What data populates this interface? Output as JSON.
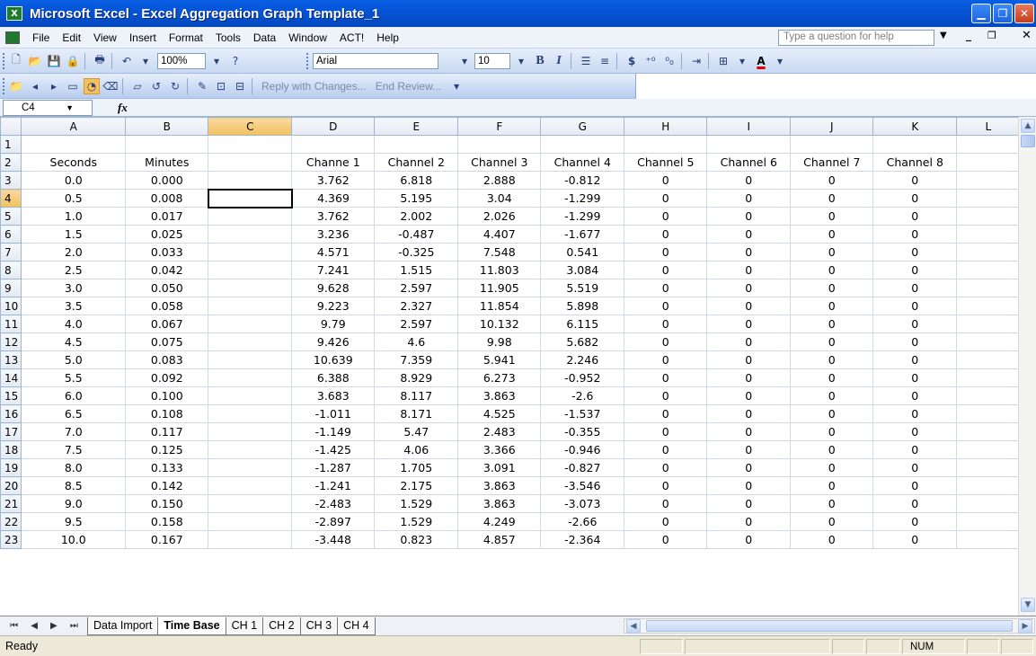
{
  "window": {
    "title": "Microsoft Excel - Excel Aggregation Graph Template_1"
  },
  "menu": {
    "items": [
      "File",
      "Edit",
      "View",
      "Insert",
      "Format",
      "Tools",
      "Data",
      "Window",
      "ACT!",
      "Help"
    ],
    "help_placeholder": "Type a question for help"
  },
  "toolbar": {
    "zoom": "100%",
    "font": "Arial",
    "font_size": "10",
    "bold": "B",
    "italic": "I",
    "currency": "$",
    "reply_with_changes": "Reply with Changes...",
    "end_review": "End Review..."
  },
  "formula_bar": {
    "name_box": "C4",
    "fx": "fx",
    "value": ""
  },
  "grid": {
    "columns": [
      "A",
      "B",
      "C",
      "D",
      "E",
      "F",
      "G",
      "H",
      "I",
      "J",
      "K",
      "L"
    ],
    "active_cell": "C4",
    "rows": [
      [
        "1",
        "",
        "",
        "",
        "",
        "",
        "",
        "",
        "",
        "",
        "",
        "",
        ""
      ],
      [
        "2",
        "Seconds",
        "Minutes",
        "",
        "Channe 1",
        "Channel 2",
        "Channel 3",
        "Channel 4",
        "Channel 5",
        "Channel 6",
        "Channel 7",
        "Channel 8",
        ""
      ],
      [
        "3",
        "0.0",
        "0.000",
        "",
        "3.762",
        "6.818",
        "2.888",
        "-0.812",
        "0",
        "0",
        "0",
        "0",
        ""
      ],
      [
        "4",
        "0.5",
        "0.008",
        "",
        "4.369",
        "5.195",
        "3.04",
        "-1.299",
        "0",
        "0",
        "0",
        "0",
        ""
      ],
      [
        "5",
        "1.0",
        "0.017",
        "",
        "3.762",
        "2.002",
        "2.026",
        "-1.299",
        "0",
        "0",
        "0",
        "0",
        ""
      ],
      [
        "6",
        "1.5",
        "0.025",
        "",
        "3.236",
        "-0.487",
        "4.407",
        "-1.677",
        "0",
        "0",
        "0",
        "0",
        ""
      ],
      [
        "7",
        "2.0",
        "0.033",
        "",
        "4.571",
        "-0.325",
        "7.548",
        "0.541",
        "0",
        "0",
        "0",
        "0",
        ""
      ],
      [
        "8",
        "2.5",
        "0.042",
        "",
        "7.241",
        "1.515",
        "11.803",
        "3.084",
        "0",
        "0",
        "0",
        "0",
        ""
      ],
      [
        "9",
        "3.0",
        "0.050",
        "",
        "9.628",
        "2.597",
        "11.905",
        "5.519",
        "0",
        "0",
        "0",
        "0",
        ""
      ],
      [
        "10",
        "3.5",
        "0.058",
        "",
        "9.223",
        "2.327",
        "11.854",
        "5.898",
        "0",
        "0",
        "0",
        "0",
        ""
      ],
      [
        "11",
        "4.0",
        "0.067",
        "",
        "9.79",
        "2.597",
        "10.132",
        "6.115",
        "0",
        "0",
        "0",
        "0",
        ""
      ],
      [
        "12",
        "4.5",
        "0.075",
        "",
        "9.426",
        "4.6",
        "9.98",
        "5.682",
        "0",
        "0",
        "0",
        "0",
        ""
      ],
      [
        "13",
        "5.0",
        "0.083",
        "",
        "10.639",
        "7.359",
        "5.941",
        "2.246",
        "0",
        "0",
        "0",
        "0",
        ""
      ],
      [
        "14",
        "5.5",
        "0.092",
        "",
        "6.388",
        "8.929",
        "6.273",
        "-0.952",
        "0",
        "0",
        "0",
        "0",
        ""
      ],
      [
        "15",
        "6.0",
        "0.100",
        "",
        "3.683",
        "8.117",
        "3.863",
        "-2.6",
        "0",
        "0",
        "0",
        "0",
        ""
      ],
      [
        "16",
        "6.5",
        "0.108",
        "",
        "-1.011",
        "8.171",
        "4.525",
        "-1.537",
        "0",
        "0",
        "0",
        "0",
        ""
      ],
      [
        "17",
        "7.0",
        "0.117",
        "",
        "-1.149",
        "5.47",
        "2.483",
        "-0.355",
        "0",
        "0",
        "0",
        "0",
        ""
      ],
      [
        "18",
        "7.5",
        "0.125",
        "",
        "-1.425",
        "4.06",
        "3.366",
        "-0.946",
        "0",
        "0",
        "0",
        "0",
        ""
      ],
      [
        "19",
        "8.0",
        "0.133",
        "",
        "-1.287",
        "1.705",
        "3.091",
        "-0.827",
        "0",
        "0",
        "0",
        "0",
        ""
      ],
      [
        "20",
        "8.5",
        "0.142",
        "",
        "-1.241",
        "2.175",
        "3.863",
        "-3.546",
        "0",
        "0",
        "0",
        "0",
        ""
      ],
      [
        "21",
        "9.0",
        "0.150",
        "",
        "-2.483",
        "1.529",
        "3.863",
        "-3.073",
        "0",
        "0",
        "0",
        "0",
        ""
      ],
      [
        "22",
        "9.5",
        "0.158",
        "",
        "-2.897",
        "1.529",
        "4.249",
        "-2.66",
        "0",
        "0",
        "0",
        "0",
        ""
      ],
      [
        "23",
        "10.0",
        "0.167",
        "",
        "-3.448",
        "0.823",
        "4.857",
        "-2.364",
        "0",
        "0",
        "0",
        "0",
        ""
      ]
    ]
  },
  "sheets": {
    "tabs": [
      "Data Import",
      "Time Base",
      "CH 1",
      "CH 2",
      "CH 3",
      "CH 4"
    ],
    "active": "Time Base"
  },
  "status": {
    "text": "Ready",
    "num": "NUM"
  },
  "colors": {
    "title_bar": "#0554d6",
    "selected_header": "#f1c15f",
    "grid_line": "#d0d7e5"
  }
}
